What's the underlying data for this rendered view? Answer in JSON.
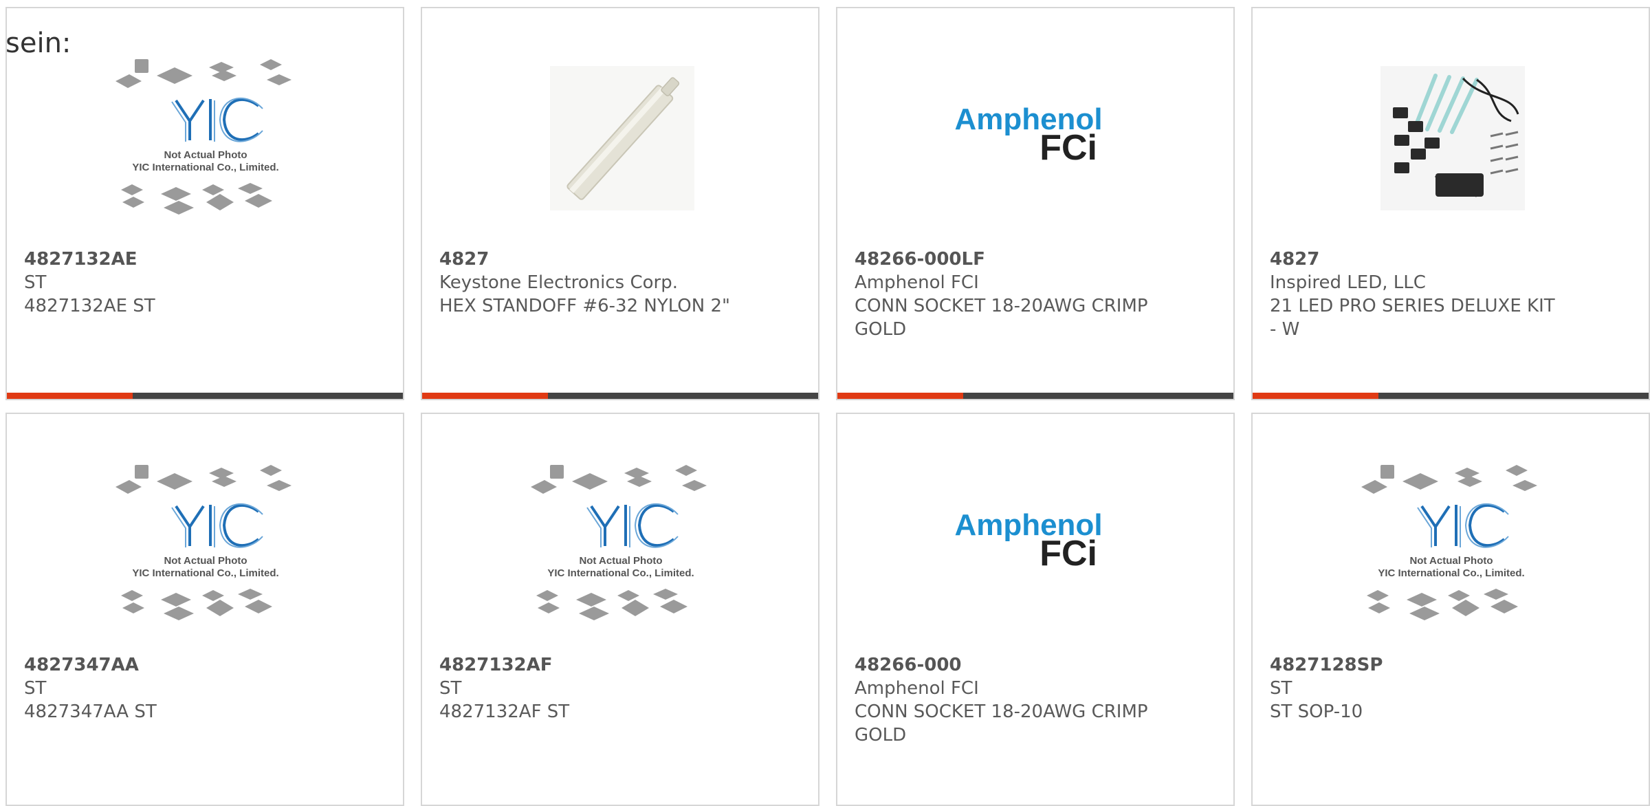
{
  "header": {
    "label": "sein:"
  },
  "colors": {
    "accent": "#e03a14",
    "bar": "#444444",
    "border": "#d6d6d6",
    "yic_blue": "#1f6fb6",
    "amphenol_blue": "#1c8fd0"
  },
  "products": [
    {
      "part": "4827132AE",
      "maker": "ST",
      "desc": "4827132AE ST",
      "image": "yic-placeholder",
      "image_caption": [
        "Not Actual Photo",
        "YIC International Co., Limited."
      ]
    },
    {
      "part": "4827",
      "maker": "Keystone Electronics Corp.",
      "desc": "HEX STANDOFF #6-32 NYLON 2\"",
      "image": "nylon-standoff"
    },
    {
      "part": "48266-000LF",
      "maker": "Amphenol FCI",
      "desc": "CONN SOCKET 18-20AWG CRIMP\nGOLD",
      "image": "amphenol-logo",
      "logo_text": [
        "Amphenol",
        "FCi"
      ]
    },
    {
      "part": "4827",
      "maker": "Inspired LED, LLC",
      "desc": "21 LED PRO SERIES DELUXE KIT\n- W",
      "image": "led-kit"
    },
    {
      "part": "4827347AA",
      "maker": "ST",
      "desc": "4827347AA ST",
      "image": "yic-placeholder",
      "image_caption": [
        "Not Actual Photo",
        "YIC International Co., Limited."
      ]
    },
    {
      "part": "4827132AF",
      "maker": "ST",
      "desc": "4827132AF ST",
      "image": "yic-placeholder",
      "image_caption": [
        "Not Actual Photo",
        "YIC International Co., Limited."
      ]
    },
    {
      "part": "48266-000",
      "maker": "Amphenol FCI",
      "desc": "CONN SOCKET 18-20AWG CRIMP\nGOLD",
      "image": "amphenol-logo",
      "logo_text": [
        "Amphenol",
        "FCi"
      ]
    },
    {
      "part": "4827128SP",
      "maker": "ST",
      "desc": "ST SOP-10",
      "image": "yic-placeholder",
      "image_caption": [
        "Not Actual Photo",
        "YIC International Co., Limited."
      ]
    }
  ]
}
